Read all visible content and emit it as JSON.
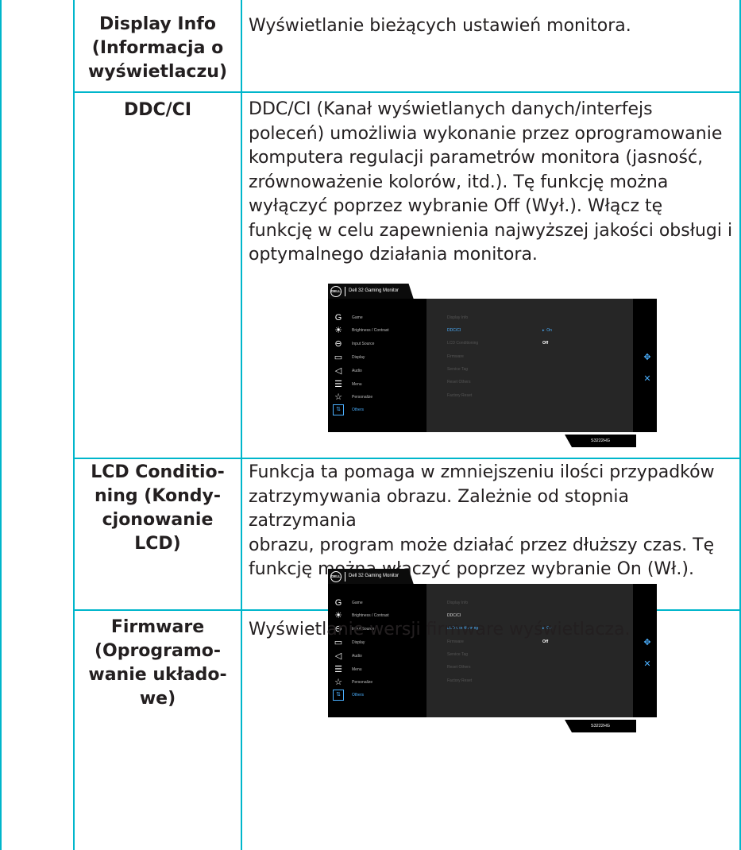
{
  "rows": [
    {
      "label_lines": [
        "Display Info",
        "(Informacja o",
        "wyświetlaczu)"
      ],
      "description_lines": [
        "Wyświetlanie bieżących ustawień monitora."
      ]
    },
    {
      "label_lines": [
        "DDC/CI"
      ],
      "description_lines": [
        "DDC/CI (Kanał wyświetlanych danych/interfejs",
        "poleceń) umożliwia wykonanie przez oprogramowanie",
        "komputera regulacji parametrów monitora (jasność,",
        "zrównoważenie kolorów, itd.). Tę funkcję można",
        "wyłączyć poprzez wybranie Off (Wył.). Włącz tę",
        "funkcję w celu zapewnienia najwyższej jakości obsługi i",
        "optymalnego działania monitora."
      ]
    },
    {
      "label_lines": [
        "LCD Conditio-",
        "ning (Kondy-",
        "cjonowanie",
        "LCD)"
      ],
      "description_lines": [
        "Funkcja ta pomaga w zmniejszeniu ilości przypadków",
        "zatrzymywania obrazu. Zależnie od stopnia zatrzymania",
        "obrazu, program może działać przez dłuższy czas. Tę",
        "funkcję można włączyć poprzez wybranie On (Wł.)."
      ]
    },
    {
      "label_lines": [
        "Firmware",
        "(Oprogramo-",
        "wanie układo-",
        "we)"
      ],
      "description_lines": [
        "Wyświetlanie wersji firmware wyświetlacza."
      ]
    }
  ],
  "osd": {
    "logo": "DELL",
    "title": "Dell 32 Gaming Monitor",
    "model": "S3222HG",
    "menu": [
      {
        "icon": "game-icon",
        "glyph": "G",
        "label": "Game"
      },
      {
        "icon": "brightness-icon",
        "glyph": "☀",
        "label": "Brightness / Contrast"
      },
      {
        "icon": "input-source-icon",
        "glyph": "⊖",
        "label": "Input Source"
      },
      {
        "icon": "display-icon",
        "glyph": "▭",
        "label": "Display"
      },
      {
        "icon": "audio-icon",
        "glyph": "◁",
        "label": "Audio"
      },
      {
        "icon": "menu-icon",
        "glyph": "☰",
        "label": "Menu"
      },
      {
        "icon": "personalize-icon",
        "glyph": "☆",
        "label": "Personalize"
      },
      {
        "icon": "others-icon",
        "glyph": "⇅",
        "label": "Others"
      }
    ],
    "submenu": [
      "Display Info",
      "DDC/CI",
      "LCD Conditioning",
      "Firmware",
      "Service Tag",
      "Reset Others",
      "Factory Reset"
    ],
    "screen1": {
      "selected_item": "DDC/CI",
      "selected_value": "On",
      "other_value": "Off"
    },
    "screen2": {
      "prev_item": "DDC/CI",
      "selected_item": "LCD Conditioning",
      "selected_value": "On",
      "other_value": "Off"
    }
  },
  "colors": {
    "rule": "#00b6cb",
    "osd_accent": "#4bb0ff"
  }
}
